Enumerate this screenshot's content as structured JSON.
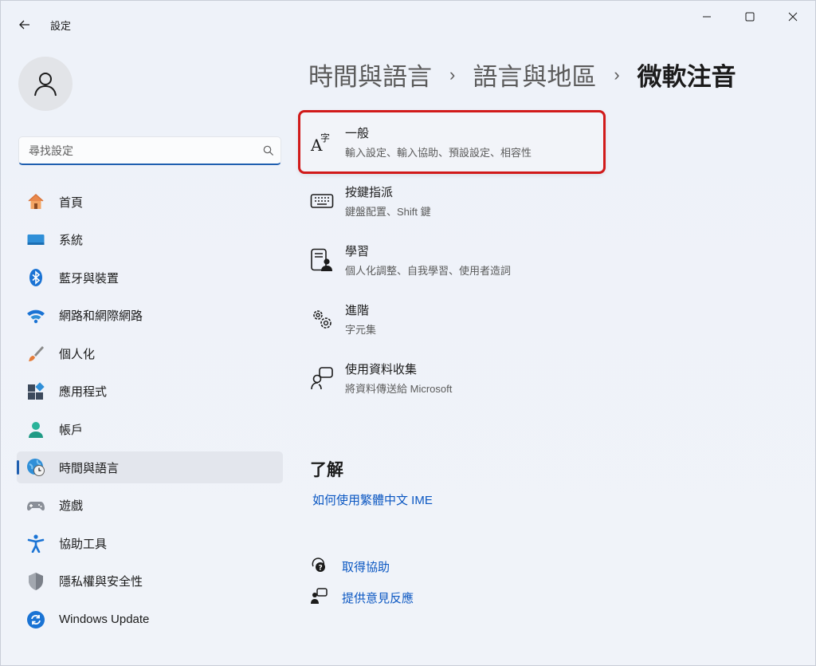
{
  "window": {
    "title": "設定"
  },
  "search": {
    "placeholder": "尋找設定"
  },
  "nav": {
    "items": [
      {
        "label": "首頁"
      },
      {
        "label": "系統"
      },
      {
        "label": "藍牙與裝置"
      },
      {
        "label": "網路和網際網路"
      },
      {
        "label": "個人化"
      },
      {
        "label": "應用程式"
      },
      {
        "label": "帳戶"
      },
      {
        "label": "時間與語言",
        "selected": true
      },
      {
        "label": "遊戲"
      },
      {
        "label": "協助工具"
      },
      {
        "label": "隱私權與安全性"
      },
      {
        "label": "Windows Update"
      }
    ]
  },
  "breadcrumb": {
    "level1": "時間與語言",
    "level2": "語言與地區",
    "current": "微軟注音",
    "separator": "›"
  },
  "settings": [
    {
      "title": "一般",
      "subtitle": "輸入設定、輸入協助、預設設定、相容性",
      "icon": "font-char-icon",
      "highlighted": true
    },
    {
      "title": "按鍵指派",
      "subtitle": "鍵盤配置、Shift 鍵",
      "icon": "keyboard-icon"
    },
    {
      "title": "學習",
      "subtitle": "個人化調整、自我學習、使用者造詞",
      "icon": "learning-icon"
    },
    {
      "title": "進階",
      "subtitle": "字元集",
      "icon": "gears-icon"
    },
    {
      "title": "使用資料收集",
      "subtitle": "將資料傳送給 Microsoft",
      "icon": "data-collection-icon"
    }
  ],
  "learn": {
    "title": "了解",
    "link": "如何使用繁體中文 IME"
  },
  "help": {
    "get_help": "取得協助",
    "feedback": "提供意見反應"
  },
  "colors": {
    "accent": "#1f5fb0",
    "link": "#0b57c2",
    "highlight_box": "#d11a1a"
  }
}
